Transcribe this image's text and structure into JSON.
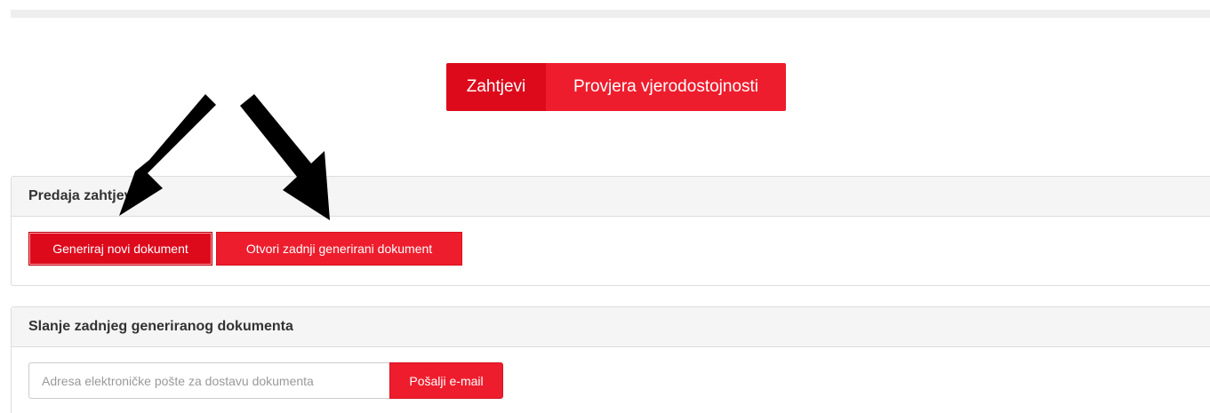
{
  "tabs": {
    "requests": "Zahtjevi",
    "verify": "Provjera vjerodostojnosti"
  },
  "panel_submit": {
    "title": "Predaja zahtjeva",
    "generate_label": "Generiraj novi dokument",
    "open_last_label": "Otvori zadnji generirani dokument"
  },
  "panel_send": {
    "title": "Slanje zadnjeg generiranog dokumenta",
    "email_placeholder": "Adresa elektroničke pošte za dostavu dokumenta",
    "email_value": "",
    "send_label": "Pošalji e-mail"
  },
  "colors": {
    "primary": "#ee1d2d",
    "primary_active": "#dd0a1c",
    "annotation_arrow": "#000000"
  },
  "icons": [
    "arrow-down-left-icon",
    "arrow-down-right-icon"
  ]
}
